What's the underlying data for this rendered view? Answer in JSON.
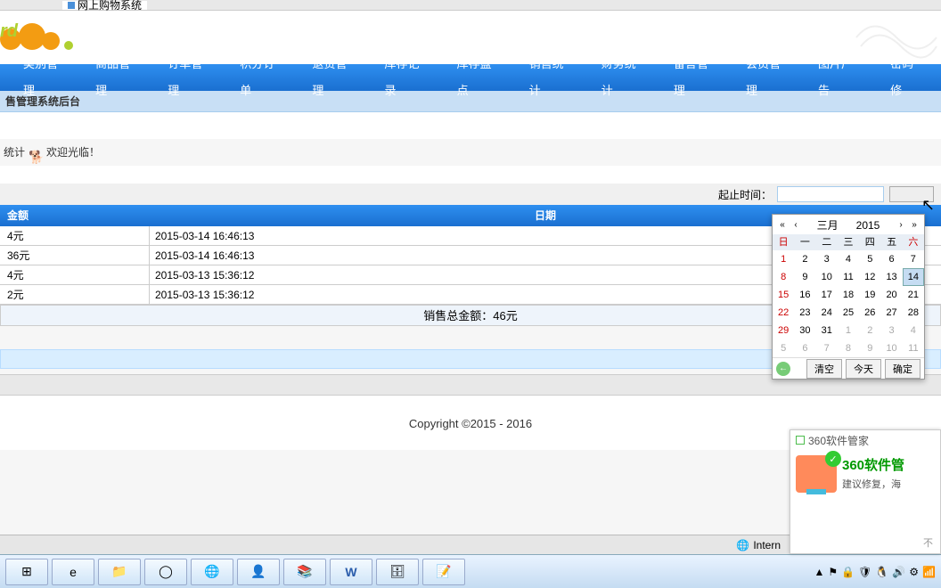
{
  "browser": {
    "tab2_label": "网上购物系统"
  },
  "menu": [
    "类别管理",
    "商品管理",
    "订单管理",
    "积分订单",
    "退货管理",
    "库存记录",
    "库存盘点",
    "销售统计",
    "财务统计",
    "留言管理",
    "会员管理",
    "图片广告",
    "密码修"
  ],
  "sub_header": "售管理系统后台",
  "greeting": {
    "prefix": "统计",
    "text": "欢迎光临！"
  },
  "query": {
    "label": "起止时间："
  },
  "table": {
    "amount_header": "金额",
    "date_header": "日期",
    "rows": [
      {
        "amount": "4元",
        "date": "2015-03-14 16:46:13"
      },
      {
        "amount": "36元",
        "date": "2015-03-14 16:46:13"
      },
      {
        "amount": "4元",
        "date": "2015-03-13 15:36:12"
      },
      {
        "amount": "2元",
        "date": "2015-03-13 15:36:12"
      }
    ],
    "sum": "销售总金额：46元"
  },
  "copyright": "Copyright ©2015 - 2016",
  "calendar": {
    "month": "三月",
    "year": "2015",
    "weekdays": [
      "日",
      "一",
      "二",
      "三",
      "四",
      "五",
      "六"
    ],
    "btn_clear": "清空",
    "btn_today": "今天",
    "btn_ok": "确定"
  },
  "status": {
    "text": "Intern"
  },
  "popup": {
    "header": "360软件管家",
    "title": "360软件管",
    "sub": "建议修复，海",
    "more": "不"
  }
}
